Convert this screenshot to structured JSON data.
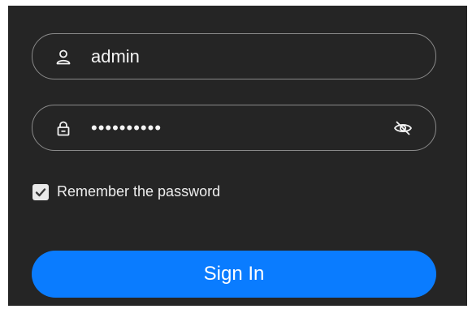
{
  "login": {
    "username": {
      "icon": "user-icon",
      "value": "admin"
    },
    "password": {
      "icon": "lock-icon",
      "value": "••••••••••",
      "toggle_icon": "eye-off-icon"
    },
    "remember": {
      "checked": true,
      "label": "Remember the password"
    },
    "submit_label": "Sign In"
  },
  "colors": {
    "panel_bg": "#252525",
    "field_border": "#8a8a8a",
    "button_bg": "#0a7cff",
    "text": "#f2f2f2"
  }
}
